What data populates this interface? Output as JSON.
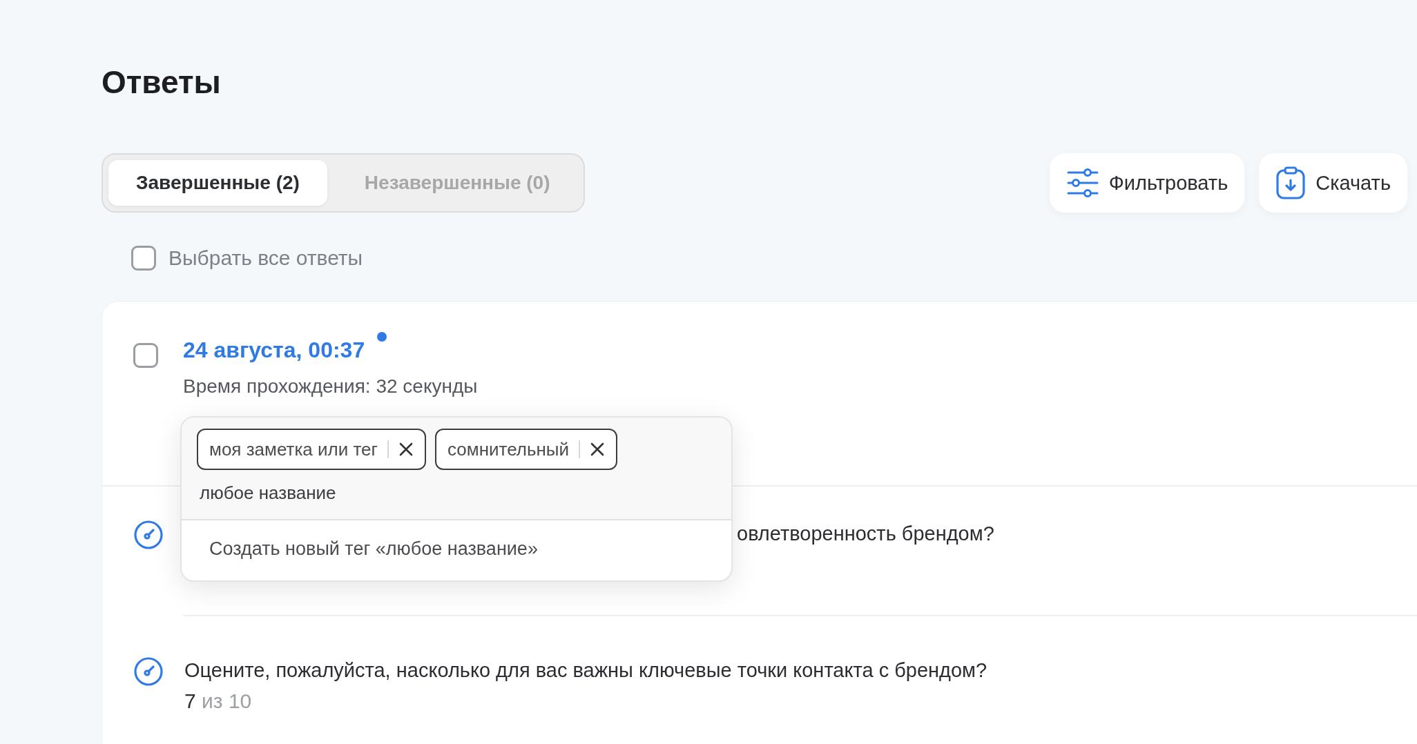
{
  "title": "Ответы",
  "tabs": [
    {
      "label": "Завершенные (2)",
      "selected": true
    },
    {
      "label": "Незавершенные (0)",
      "selected": false
    }
  ],
  "actions": [
    {
      "label": "Фильтровать",
      "kind": "filter"
    },
    {
      "label": "Скачать",
      "kind": "download"
    }
  ],
  "select_all": {
    "label": "Выбрать все ответы",
    "checked": false
  },
  "response": {
    "checked": false,
    "date": "24 августа, 00:37",
    "unread": true,
    "duration": "Время прохождения: 32 секунды",
    "tag_editor": {
      "tags": [
        {
          "label": "моя заметка или тег"
        },
        {
          "label": "сомнительный"
        }
      ],
      "value": "любое название",
      "suggestion": "Создать новый тег «любое название»"
    },
    "answers": [
      {
        "question": "овлетворенность брендом?"
      },
      {
        "question": "Оцените, пожалуйста, насколько для вас важны ключевые точки контакта с брендом?",
        "score": "7",
        "scale": "из 10"
      }
    ]
  }
}
